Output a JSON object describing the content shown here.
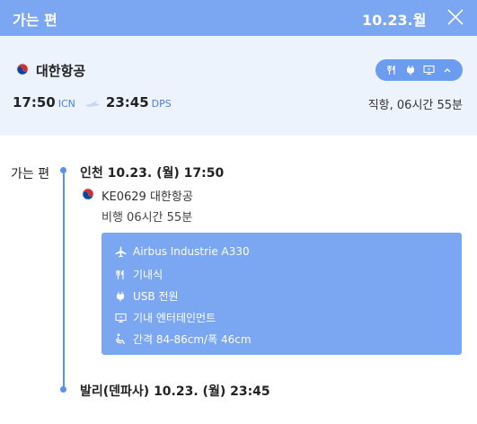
{
  "header": {
    "title": "가는 편",
    "date": "10.23.월"
  },
  "summary": {
    "airline": "대한항공",
    "departure_time": "17:50",
    "departure_code": "ICN",
    "arrival_time": "23:45",
    "arrival_code": "DPS",
    "duration_text": "직항, 06시간 55분",
    "amenity_icons": [
      "meal-icon",
      "plug-icon",
      "screen-icon",
      "chevron-up-icon"
    ]
  },
  "detail": {
    "leg_label": "가는 편",
    "departure": "인천 10.23. (월) 17:50",
    "flight_number": "KE0629 대한항공",
    "flight_duration": "비행 06시간 55분",
    "info": [
      {
        "icon": "plane-icon",
        "text": "Airbus Industrie A330"
      },
      {
        "icon": "meal-icon",
        "text": "기내식"
      },
      {
        "icon": "plug-icon",
        "text": "USB 전원"
      },
      {
        "icon": "screen-icon",
        "text": "기내 엔터테인먼트"
      },
      {
        "icon": "seat-icon",
        "text": "간격 84-86cm/폭 46cm"
      }
    ],
    "arrival": "발리(덴파사) 10.23. (월) 23:45"
  },
  "colors": {
    "header_bg": "#7aa6f2",
    "summary_bg": "#edf3fd",
    "accent": "#5d8ff0",
    "airline_red": "#cd2e3a",
    "airline_blue": "#0047a0"
  }
}
